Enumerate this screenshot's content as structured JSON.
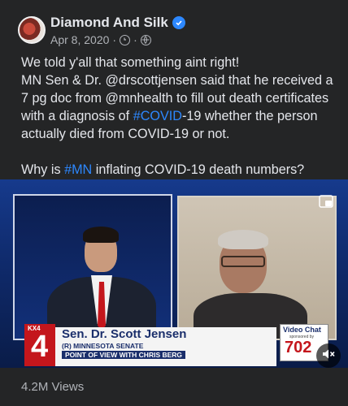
{
  "post": {
    "author": "Diamond And Silk",
    "date": "Apr 8, 2020",
    "separator": "·",
    "paragraph1_lines": [
      "We told y'all that something aint right!",
      "MN Sen & Dr. @drscottjensen said that he received a",
      "7 pg doc from @mnhealth to fill out death certificates"
    ],
    "paragraph1_line4_pre": "with a diagnosis of ",
    "paragraph1_line4_tag": "#COVID",
    "paragraph1_line4_post": "-19 whether the person",
    "paragraph1_line5": "actually died from COVID-19 or not.",
    "paragraph2_pre": "Why is ",
    "paragraph2_tag": "#MN",
    "paragraph2_post": " inflating COVID-19 death numbers?"
  },
  "video": {
    "station_label": "KX4",
    "station_number": "4",
    "lower_third_name": "Sen. Dr. Scott Jensen",
    "lower_third_sub1": "(R) MINNESOTA SENATE",
    "lower_third_sub2": "POINT OF VIEW WITH CHRIS BERG",
    "video_chat_title": "Video Chat",
    "video_chat_sponsor": "sponsored by",
    "video_chat_number": "702"
  },
  "stats": {
    "views": "4.2M Views"
  },
  "colors": {
    "background": "#242526",
    "text": "#e4e6eb",
    "secondary_text": "#b0b3b8",
    "link": "#2d88ff"
  },
  "icons": {
    "verified": "verified-badge-icon",
    "clock": "clock-icon",
    "globe": "globe-icon",
    "expand": "expand-icon",
    "mute": "speaker-muted-icon"
  }
}
